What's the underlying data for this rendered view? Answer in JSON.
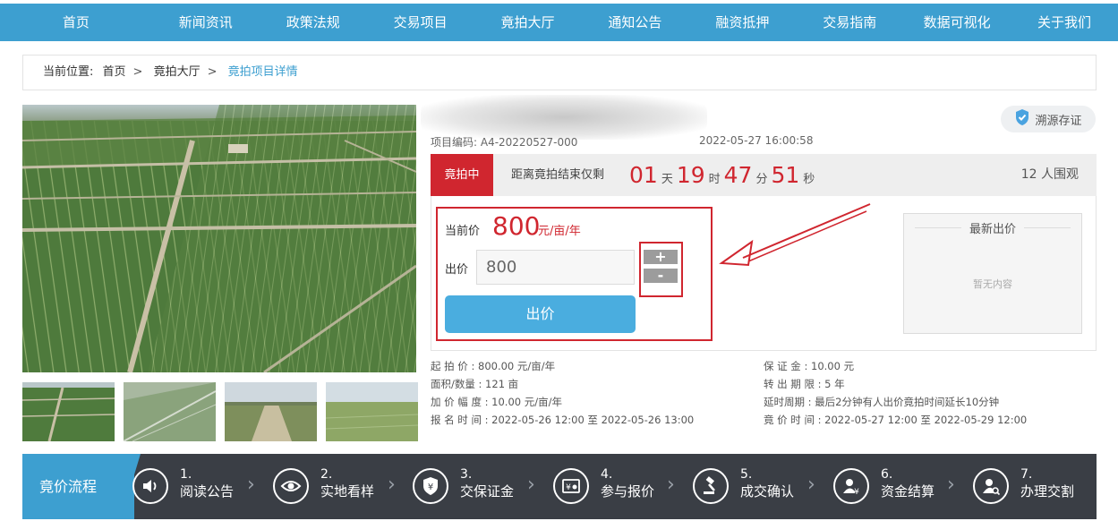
{
  "nav": {
    "items": [
      "首页",
      "新闻资讯",
      "政策法规",
      "交易项目",
      "竟拍大厅",
      "通知公告",
      "融资抵押",
      "交易指南",
      "数据可视化",
      "关于我们"
    ]
  },
  "breadcrumb": {
    "prefix": "当前位置:",
    "items": [
      "首页",
      "竟拍大厅"
    ],
    "separator": ">",
    "current": "竟拍项目详情"
  },
  "project": {
    "code_text": "项目编码: A4-20220527-000",
    "time_text": "2022-05-27 16:00:58",
    "trace_label": "溯源存证"
  },
  "status": {
    "tag": "竟拍中",
    "countdown_label": "距离竟拍结束仅剩",
    "days": "01",
    "days_unit": "天",
    "hours": "19",
    "hours_unit": "时",
    "minutes": "47",
    "minutes_unit": "分",
    "seconds": "51",
    "seconds_unit": "秒",
    "viewers": "12 人围观"
  },
  "bid": {
    "current_label": "当前价",
    "current_value": "800",
    "current_unit": "元/亩/年",
    "input_label": "出价",
    "input_value": "800",
    "plus_label": "+",
    "minus_label": "-",
    "submit_label": "出价"
  },
  "latest": {
    "title": "最新出价",
    "empty_text": "暂无内容"
  },
  "details": {
    "start_price": "起 拍 价 : 800.00 元/亩/年",
    "area": "面积/数量 : 121 亩",
    "increment": "加 价 幅 度 : 10.00 元/亩/年",
    "signup_time": "报 名 时 间 : 2022-05-26 12:00 至 2022-05-26 13:00",
    "deposit": "保 证 金 : 10.00 元",
    "term": "转 出 期 限 : 5 年",
    "delay": "延时周期 : 最后2分钟有人出价竟拍时间延长10分钟",
    "bid_time": "竟 价 时 间 : 2022-05-27 12:00 至 2022-05-29 12:00"
  },
  "process": {
    "title": "竟价流程",
    "steps": [
      {
        "num": "1.",
        "label": "阅读公告",
        "icon": "speaker-icon"
      },
      {
        "num": "2.",
        "label": "实地看样",
        "icon": "eye-icon"
      },
      {
        "num": "3.",
        "label": "交保证金",
        "icon": "shield-yen-icon"
      },
      {
        "num": "4.",
        "label": "参与报价",
        "icon": "quote-icon"
      },
      {
        "num": "5.",
        "label": "成交确认",
        "icon": "gavel-icon"
      },
      {
        "num": "6.",
        "label": "资金结算",
        "icon": "user-yen-icon"
      },
      {
        "num": "7.",
        "label": "办理交割",
        "icon": "user-search-icon"
      }
    ]
  },
  "colors": {
    "nav_blue": "#3d9fd0",
    "accent_red": "#d0262f",
    "button_blue": "#4aaddf",
    "process_dark": "#3a3e45"
  }
}
